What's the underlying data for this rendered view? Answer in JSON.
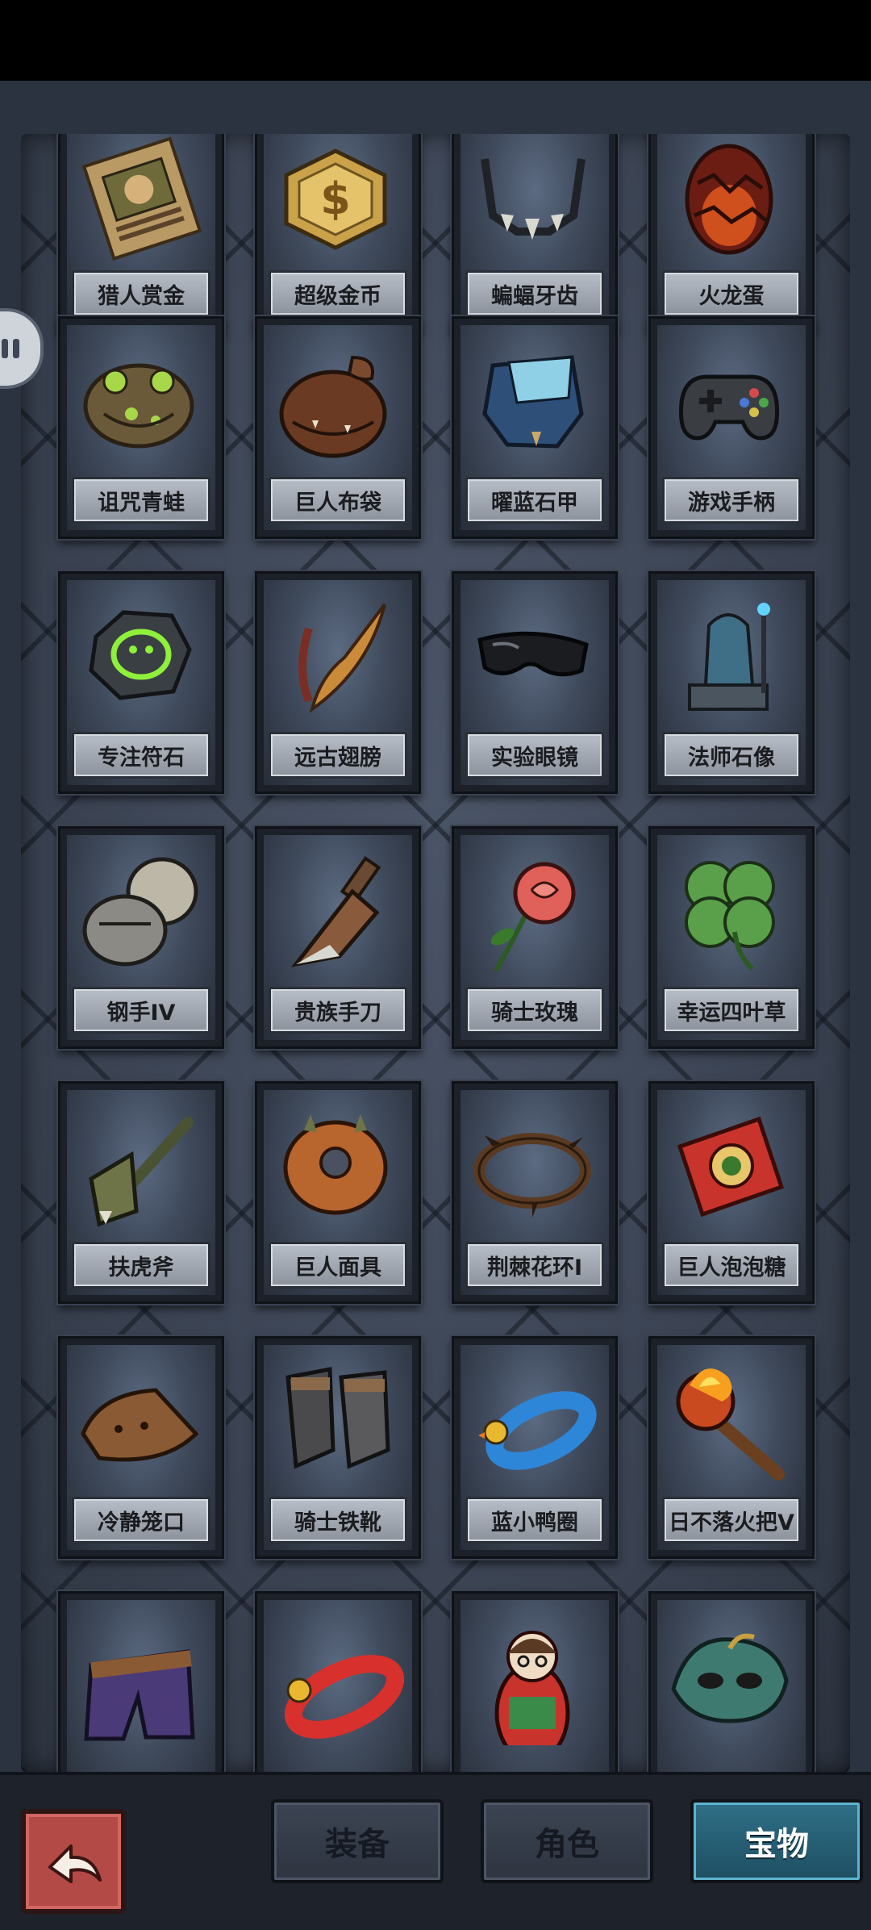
{
  "items": [
    {
      "label": "猎人赏金",
      "icon": "wanted-poster-icon"
    },
    {
      "label": "超级金币",
      "icon": "gold-coin-icon"
    },
    {
      "label": "蝙蝠牙齿",
      "icon": "bat-teeth-icon"
    },
    {
      "label": "火龙蛋",
      "icon": "dragon-egg-icon"
    },
    {
      "label": "诅咒青蛙",
      "icon": "cursed-frog-icon"
    },
    {
      "label": "巨人布袋",
      "icon": "giant-sack-icon"
    },
    {
      "label": "曜蓝石甲",
      "icon": "blue-stone-armor-icon"
    },
    {
      "label": "游戏手柄",
      "icon": "gamepad-icon"
    },
    {
      "label": "专注符石",
      "icon": "rune-stone-icon"
    },
    {
      "label": "远古翅膀",
      "icon": "ancient-wing-icon"
    },
    {
      "label": "实验眼镜",
      "icon": "goggles-icon"
    },
    {
      "label": "法师石像",
      "icon": "mage-statue-icon"
    },
    {
      "label": "钢手IV",
      "icon": "steel-gauntlet-icon"
    },
    {
      "label": "贵族手刀",
      "icon": "noble-knife-icon"
    },
    {
      "label": "骑士玫瑰",
      "icon": "rose-icon"
    },
    {
      "label": "幸运四叶草",
      "icon": "four-leaf-clover-icon"
    },
    {
      "label": "扶虎斧",
      "icon": "axe-icon"
    },
    {
      "label": "巨人面具",
      "icon": "giant-mask-icon"
    },
    {
      "label": "荆棘花环I",
      "icon": "thorn-wreath-icon"
    },
    {
      "label": "巨人泡泡糖",
      "icon": "bubblegum-box-icon"
    },
    {
      "label": "冷静笼口",
      "icon": "muzzle-icon"
    },
    {
      "label": "骑士铁靴",
      "icon": "iron-boots-icon"
    },
    {
      "label": "蓝小鸭圈",
      "icon": "blue-duck-ring-icon"
    },
    {
      "label": "日不落火把V",
      "icon": "torch-icon"
    },
    {
      "label": "",
      "icon": "shorts-icon"
    },
    {
      "label": "",
      "icon": "red-duck-ring-icon"
    },
    {
      "label": "",
      "icon": "nesting-doll-icon"
    },
    {
      "label": "",
      "icon": "masquerade-mask-icon"
    }
  ],
  "tabs": {
    "equipment": "装备",
    "character": "角色",
    "treasure": "宝物"
  },
  "colors": {
    "active_tab": "#1e4f63",
    "back_button": "#b34a46"
  }
}
